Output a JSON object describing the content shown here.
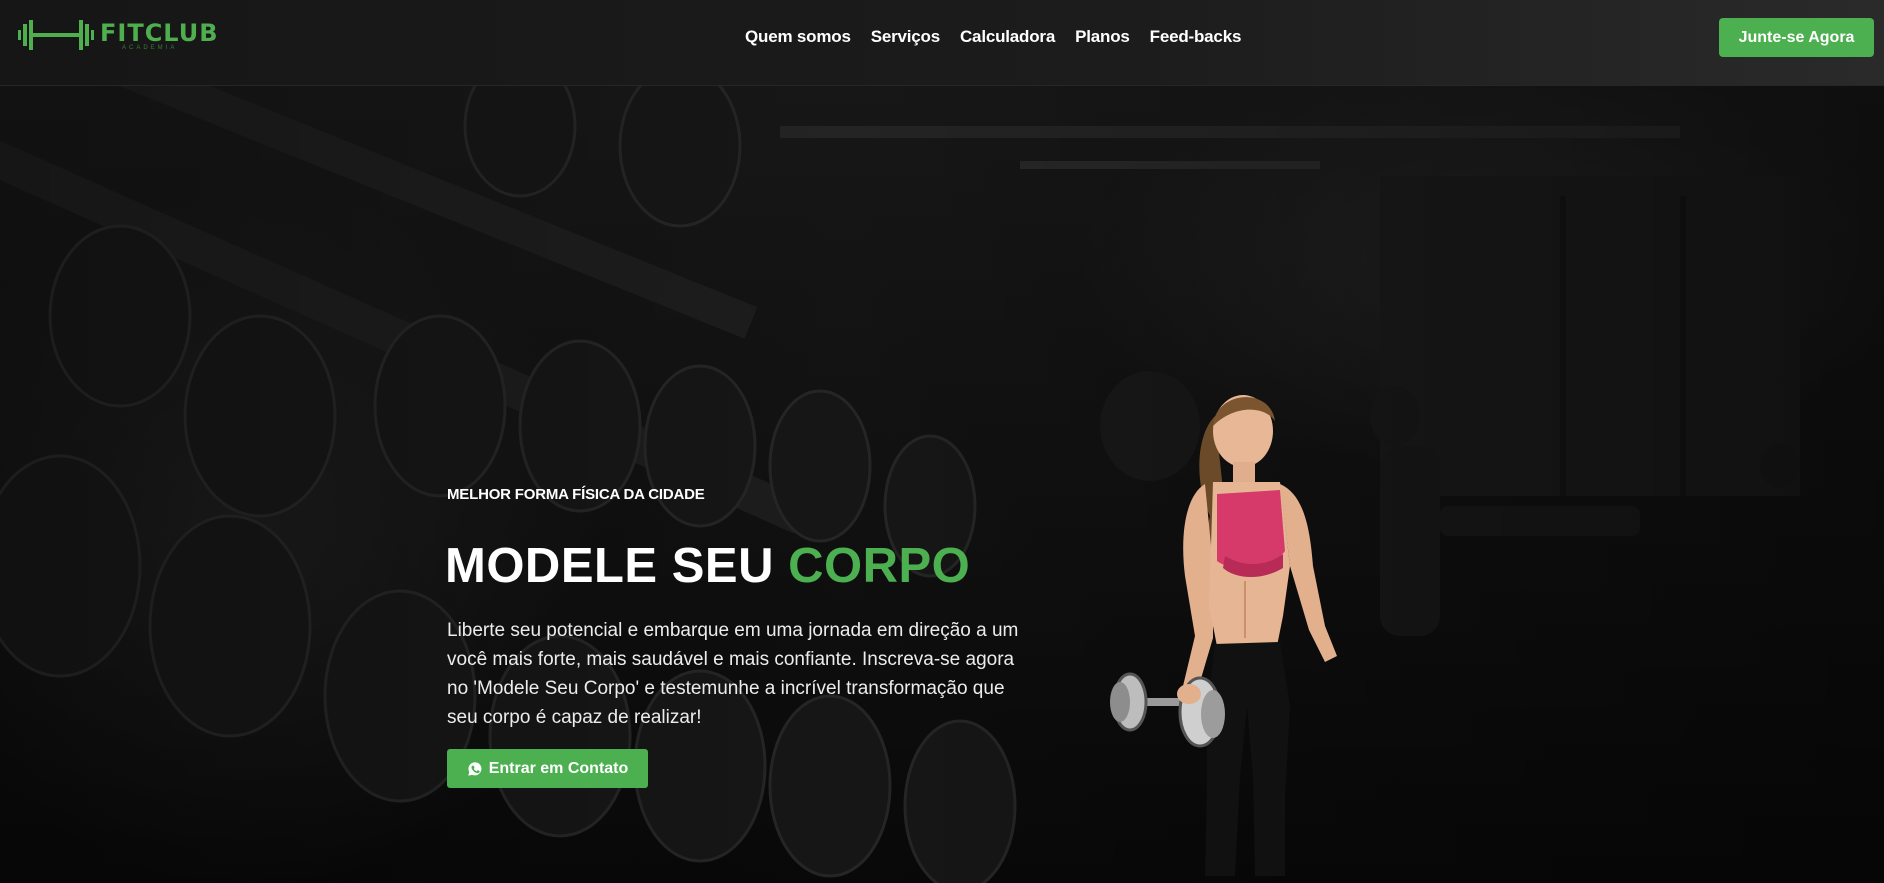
{
  "brand": {
    "name": "FITCLUB",
    "tagline": "ACADEMIA",
    "accent_color": "#4caf50"
  },
  "nav": {
    "items": [
      "Quem somos",
      "Serviços",
      "Calculadora",
      "Planos",
      "Feed-backs"
    ]
  },
  "header": {
    "cta_label": "Junte-se Agora"
  },
  "hero": {
    "eyebrow": "MELHOR FORMA FÍSICA DA CIDADE",
    "headline_main": "MODELE SEU ",
    "headline_accent": "CORPO",
    "description": "Liberte seu potencial e embarque em uma jornada em direção a um você mais forte, mais saudável e mais confiante. Inscreva-se agora no 'Modele Seu Corpo' e testemunhe a incrível transformação que seu corpo é capaz de realizar!",
    "cta_label": "Entrar em Contato",
    "cta_icon": "whatsapp-icon"
  }
}
